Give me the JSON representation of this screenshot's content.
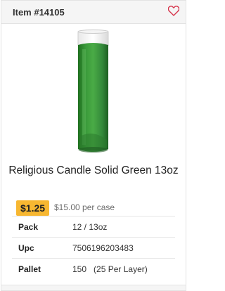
{
  "header": {
    "item_number": "Item #14105"
  },
  "product": {
    "title": "Religious Candle Solid Green 13oz",
    "unit_price": "$1.25",
    "case_price": "$15.00 per case",
    "specs": [
      {
        "label": "Pack",
        "value": "12 / 13oz"
      },
      {
        "label": "Upc",
        "value": "7506196203483"
      },
      {
        "label": "Pallet",
        "value": "150",
        "note": "(25 Per Layer)"
      }
    ]
  },
  "icons": {
    "favorite": "heart-outline-icon"
  },
  "colors": {
    "price_badge": "#f7b731",
    "heart": "#d6334a",
    "candle": "#3a9a3a"
  }
}
